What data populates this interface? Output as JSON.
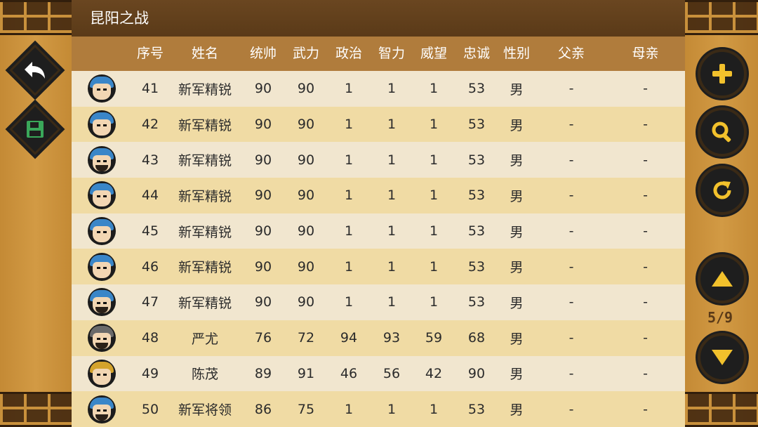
{
  "title": "昆阳之战",
  "columns": [
    "序号",
    "姓名",
    "统帅",
    "武力",
    "政治",
    "智力",
    "威望",
    "忠诚",
    "性别",
    "父亲",
    "母亲"
  ],
  "rows": [
    {
      "avatar": "blue-helmet",
      "id": "41",
      "name": "新军精锐",
      "lead": "90",
      "war": "90",
      "pol": "1",
      "int": "1",
      "pres": "1",
      "loyal": "53",
      "sex": "男",
      "father": "-",
      "mother": "-"
    },
    {
      "avatar": "blue-helmet",
      "id": "42",
      "name": "新军精锐",
      "lead": "90",
      "war": "90",
      "pol": "1",
      "int": "1",
      "pres": "1",
      "loyal": "53",
      "sex": "男",
      "father": "-",
      "mother": "-"
    },
    {
      "avatar": "blue-helmet-bearded",
      "id": "43",
      "name": "新军精锐",
      "lead": "90",
      "war": "90",
      "pol": "1",
      "int": "1",
      "pres": "1",
      "loyal": "53",
      "sex": "男",
      "father": "-",
      "mother": "-"
    },
    {
      "avatar": "blue-helmet",
      "id": "44",
      "name": "新军精锐",
      "lead": "90",
      "war": "90",
      "pol": "1",
      "int": "1",
      "pres": "1",
      "loyal": "53",
      "sex": "男",
      "father": "-",
      "mother": "-"
    },
    {
      "avatar": "blue-helmet",
      "id": "45",
      "name": "新军精锐",
      "lead": "90",
      "war": "90",
      "pol": "1",
      "int": "1",
      "pres": "1",
      "loyal": "53",
      "sex": "男",
      "father": "-",
      "mother": "-"
    },
    {
      "avatar": "blue-helmet",
      "id": "46",
      "name": "新军精锐",
      "lead": "90",
      "war": "90",
      "pol": "1",
      "int": "1",
      "pres": "1",
      "loyal": "53",
      "sex": "男",
      "father": "-",
      "mother": "-"
    },
    {
      "avatar": "blue-helmet-bearded",
      "id": "47",
      "name": "新军精锐",
      "lead": "90",
      "war": "90",
      "pol": "1",
      "int": "1",
      "pres": "1",
      "loyal": "53",
      "sex": "男",
      "father": "-",
      "mother": "-"
    },
    {
      "avatar": "gray-helmet-bearded",
      "id": "48",
      "name": "严尤",
      "lead": "76",
      "war": "72",
      "pol": "94",
      "int": "93",
      "pres": "59",
      "loyal": "68",
      "sex": "男",
      "father": "-",
      "mother": "-"
    },
    {
      "avatar": "gold-crown",
      "id": "49",
      "name": "陈茂",
      "lead": "89",
      "war": "91",
      "pol": "46",
      "int": "56",
      "pres": "42",
      "loyal": "90",
      "sex": "男",
      "father": "-",
      "mother": "-"
    },
    {
      "avatar": "blue-helmet-bearded",
      "id": "50",
      "name": "新军将领",
      "lead": "86",
      "war": "75",
      "pol": "1",
      "int": "1",
      "pres": "1",
      "loyal": "53",
      "sex": "男",
      "father": "-",
      "mother": "-"
    }
  ],
  "left_buttons": [
    {
      "name": "back-button",
      "icon": "back-arrow-icon"
    },
    {
      "name": "save-button",
      "icon": "floppy-disk-icon"
    }
  ],
  "right_buttons": [
    {
      "name": "add-button",
      "icon": "plus-icon"
    },
    {
      "name": "search-button",
      "icon": "magnifier-icon"
    },
    {
      "name": "refresh-button",
      "icon": "refresh-icon"
    },
    {
      "name": "page-up-button",
      "icon": "triangle-up-icon"
    },
    {
      "name": "page-down-button",
      "icon": "triangle-down-icon"
    }
  ],
  "pagination": "5/9",
  "colors": {
    "title_bg": "#5a3a18",
    "header_bg": "#b07c3c",
    "row_odd": "#f1e6cf",
    "row_even": "#f0dba4",
    "side_bg": "#c9913c",
    "button_bg": "#1e1e1e",
    "button_icon": "#f2c12c",
    "save_icon": "#3aa85a"
  }
}
